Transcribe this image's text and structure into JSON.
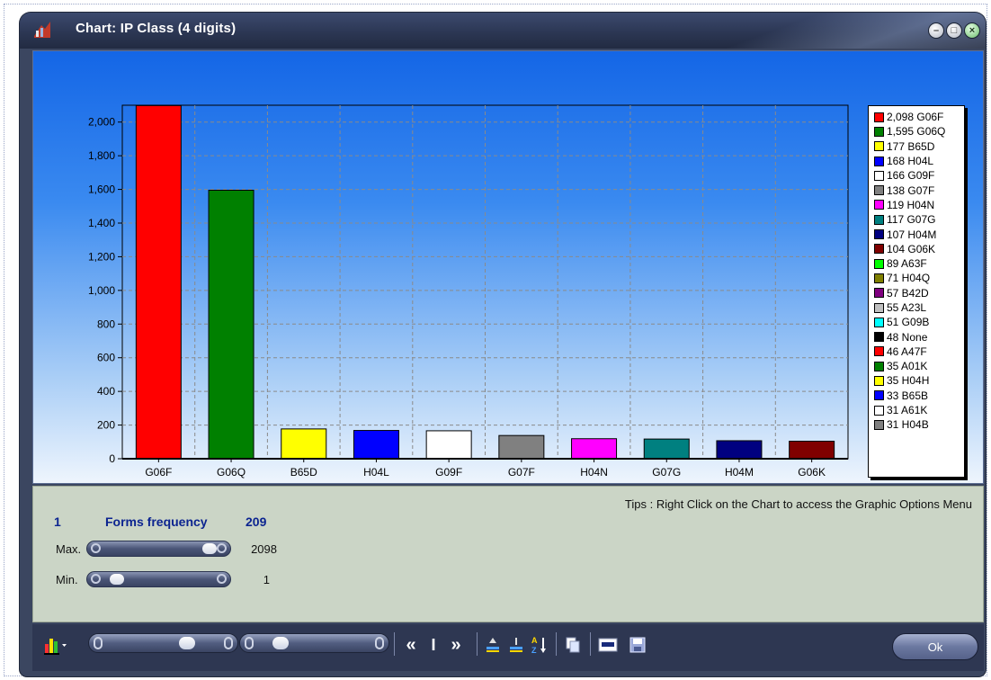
{
  "window": {
    "title": "Chart: IP Class (4 digits)"
  },
  "chart_data": {
    "type": "bar",
    "categories": [
      "G06F",
      "G06Q",
      "B65D",
      "H04L",
      "G09F",
      "G07F",
      "H04N",
      "G07G",
      "H04M",
      "G06K"
    ],
    "values": [
      2098,
      1595,
      177,
      168,
      166,
      138,
      119,
      117,
      107,
      104
    ],
    "colors": [
      "#ff0000",
      "#008000",
      "#ffff00",
      "#0000ff",
      "#ffffff",
      "#808080",
      "#ff00ff",
      "#008080",
      "#000080",
      "#800000"
    ],
    "y_ticks": [
      "0",
      "200",
      "400",
      "600",
      "800",
      "1,000",
      "1,200",
      "1,400",
      "1,600",
      "1,800",
      "2,000"
    ],
    "ylim": [
      0,
      2100
    ],
    "grid": true,
    "title": "",
    "xlabel": "",
    "ylabel": "",
    "legend_position": "right",
    "legend": [
      {
        "label": "2,098 G06F",
        "color": "#ff0000"
      },
      {
        "label": "1,595 G06Q",
        "color": "#008000"
      },
      {
        "label": "177 B65D",
        "color": "#ffff00"
      },
      {
        "label": "168 H04L",
        "color": "#0000ff"
      },
      {
        "label": "166 G09F",
        "color": "#ffffff"
      },
      {
        "label": "138 G07F",
        "color": "#808080"
      },
      {
        "label": "119 H04N",
        "color": "#ff00ff"
      },
      {
        "label": "117 G07G",
        "color": "#008080"
      },
      {
        "label": "107 H04M",
        "color": "#000080"
      },
      {
        "label": "104 G06K",
        "color": "#800000"
      },
      {
        "label": "89 A63F",
        "color": "#00ff00"
      },
      {
        "label": "71 H04Q",
        "color": "#808000"
      },
      {
        "label": "57 B42D",
        "color": "#800080"
      },
      {
        "label": "55 A23L",
        "color": "#c0c0c0"
      },
      {
        "label": "51 G09B",
        "color": "#00ffff"
      },
      {
        "label": "48 None",
        "color": "#000000"
      },
      {
        "label": "46 A47F",
        "color": "#ff0000"
      },
      {
        "label": "35 A01K",
        "color": "#008000"
      },
      {
        "label": "35 H04H",
        "color": "#ffff00"
      },
      {
        "label": "33 B65B",
        "color": "#0000ff"
      },
      {
        "label": "31 A61K",
        "color": "#ffffff"
      },
      {
        "label": "31 H04B",
        "color": "#808080"
      }
    ]
  },
  "info": {
    "tips": "Tips : Right Click on the Chart to access the Graphic Options Menu",
    "min_count": "1",
    "field_label": "Forms frequency",
    "max_count": "209",
    "max_label": "Max.",
    "max_value": "2098",
    "min_label": "Min.",
    "min_value": "1",
    "max_slider_level": 0.95,
    "min_slider_level": 0.05
  },
  "toolbar": {
    "ok_label": "Ok",
    "first_symbol": "«",
    "play_symbol": "I",
    "last_symbol": "»"
  },
  "colors": {
    "title_bar": "#2c3754",
    "chart_gradient_top": "#1466e6",
    "info_panel": "#cbd5c6",
    "accent_text": "#0c2490"
  }
}
